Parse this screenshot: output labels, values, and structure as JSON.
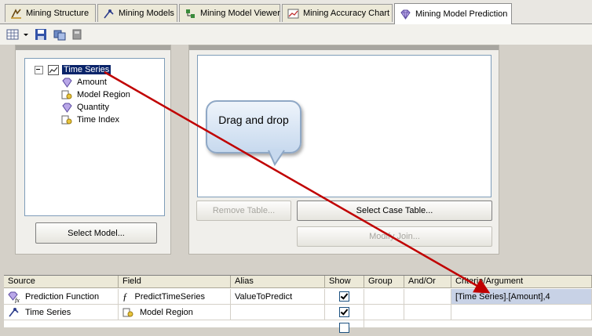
{
  "tabs": [
    {
      "label": "Mining Structure",
      "icon": "mining-structure-icon"
    },
    {
      "label": "Mining Models",
      "icon": "mining-models-icon"
    },
    {
      "label": "Mining Model Viewer",
      "icon": "viewer-icon"
    },
    {
      "label": "Mining Accuracy Chart",
      "icon": "accuracy-chart-icon"
    },
    {
      "label": "Mining Model Prediction",
      "icon": "prediction-diamond-icon",
      "active": true
    }
  ],
  "model_tree": {
    "root": "Time Series",
    "children": [
      "Amount",
      "Model Region",
      "Quantity",
      "Time Index"
    ]
  },
  "buttons": {
    "select_model": "Select Model...",
    "remove_table": "Remove Table...",
    "select_case_table": "Select Case Table...",
    "modify_join": "Modify Join..."
  },
  "callout": {
    "text": "Drag and drop"
  },
  "grid": {
    "columns": [
      "Source",
      "Field",
      "Alias",
      "Show",
      "Group",
      "And/Or",
      "Criteria/Argument"
    ],
    "rows": [
      {
        "source": "Prediction Function",
        "field": "PredictTimeSeries",
        "alias": "ValueToPredict",
        "show": true,
        "criteria": "[Time Series].[Amount],4"
      },
      {
        "source": "Time Series",
        "field": "Model Region",
        "alias": "",
        "show": true,
        "criteria": ""
      }
    ]
  },
  "colors": {
    "arrow": "#c00000",
    "selection": "#0a246a"
  }
}
